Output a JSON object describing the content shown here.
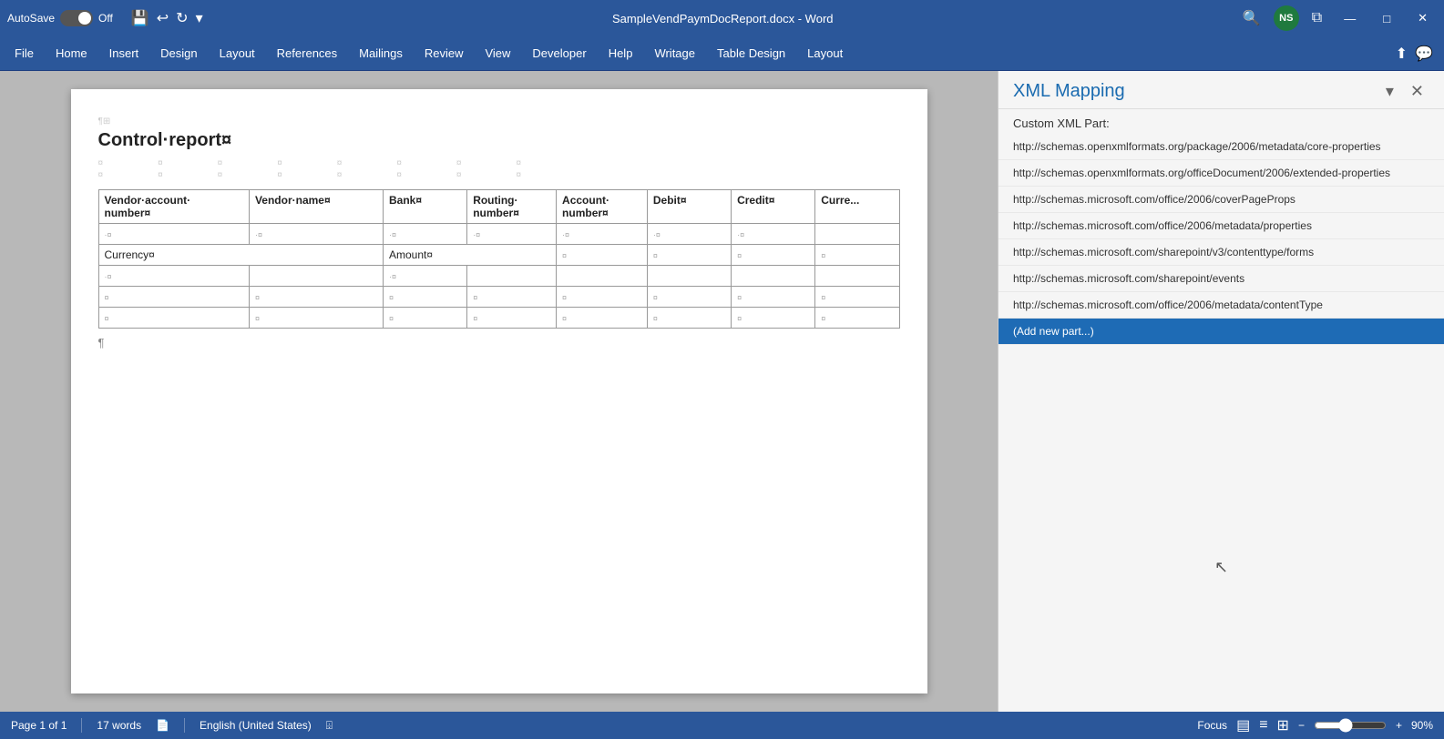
{
  "titlebar": {
    "autosave_label": "AutoSave",
    "autosave_state": "Off",
    "document_title": "SampleVendPaymDocReport.docx - Word",
    "save_icon": "💾",
    "undo_icon": "↩",
    "redo_icon": "↻",
    "dropdown_icon": "▾",
    "search_icon": "🔍",
    "avatar_initials": "NS",
    "restore_icon": "⧉",
    "minimize_icon": "—",
    "maximize_icon": "□",
    "close_icon": "✕"
  },
  "menubar": {
    "items": [
      {
        "label": "File",
        "active": false
      },
      {
        "label": "Home",
        "active": false
      },
      {
        "label": "Insert",
        "active": false
      },
      {
        "label": "Design",
        "active": false
      },
      {
        "label": "Layout",
        "active": false
      },
      {
        "label": "References",
        "active": false
      },
      {
        "label": "Mailings",
        "active": false
      },
      {
        "label": "Review",
        "active": false
      },
      {
        "label": "View",
        "active": false
      },
      {
        "label": "Developer",
        "active": false
      },
      {
        "label": "Help",
        "active": false
      },
      {
        "label": "Writage",
        "active": false
      },
      {
        "label": "Table Design",
        "active": false
      },
      {
        "label": "Layout",
        "active": false
      }
    ],
    "share_icon": "⬆",
    "comment_icon": "💬"
  },
  "document": {
    "title": "Control·report¤",
    "pilcrow": "¶",
    "table": {
      "headers": [
        "Vendor·account·number¤",
        "Vendor·name¤",
        "Bank¤",
        "Routing·number¤",
        "Account·number¤",
        "Debit¤",
        "Credit¤",
        "Curr..."
      ],
      "row1": [
        "·¤",
        "·¤",
        "·¤",
        "·¤",
        "·¤",
        "·¤",
        "·¤",
        ""
      ],
      "currency_row": [
        "Currency¤",
        "",
        "Amount¤",
        "",
        "¤",
        "¤",
        "¤",
        "¤"
      ],
      "row2": [
        "·¤",
        "",
        "·¤",
        "",
        "",
        "",
        "",
        ""
      ],
      "row3": [
        "¤",
        "¤",
        "¤",
        "¤",
        "¤",
        "¤",
        "¤",
        "¤"
      ],
      "row4": [
        "¤",
        "¤",
        "¤",
        "¤",
        "¤",
        "¤",
        "¤",
        "¤"
      ]
    }
  },
  "xml_panel": {
    "title": "XML Mapping",
    "dropdown_icon": "▾",
    "close_icon": "✕",
    "custom_xml_part_label": "Custom XML Part:",
    "selected_option": "http://schemas.openxmlformats.org/package/2006/m...",
    "options": [
      {
        "label": "http://schemas.openxmlformats.org/package/2006/metadata/core-properties",
        "selected": false
      },
      {
        "label": "http://schemas.openxmlformats.org/officeDocument/2006/extended-properties",
        "selected": false
      },
      {
        "label": "http://schemas.microsoft.com/office/2006/coverPageProps",
        "selected": false
      },
      {
        "label": "http://schemas.microsoft.com/office/2006/metadata/properties",
        "selected": false
      },
      {
        "label": "http://schemas.microsoft.com/sharepoint/v3/contenttype/forms",
        "selected": false
      },
      {
        "label": "http://schemas.microsoft.com/sharepoint/events",
        "selected": false
      },
      {
        "label": "http://schemas.microsoft.com/office/2006/metadata/contentType",
        "selected": false
      },
      {
        "label": "(Add new part...)",
        "selected": true
      }
    ]
  },
  "statusbar": {
    "page_label": "Page 1 of 1",
    "words_label": "17 words",
    "language_label": "English (United States)",
    "focus_label": "Focus",
    "zoom_percent": "90%",
    "zoom_value": 90
  }
}
